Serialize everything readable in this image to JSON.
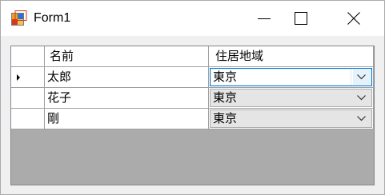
{
  "window": {
    "title": "Form1"
  },
  "grid": {
    "columns": [
      "名前",
      "住居地域"
    ],
    "rows": [
      {
        "name": "太郎",
        "area": "東京",
        "current": true
      },
      {
        "name": "花子",
        "area": "東京",
        "current": false
      },
      {
        "name": "剛",
        "area": "東京",
        "current": false
      }
    ]
  },
  "icons": {
    "app": "form-icon",
    "minimize": "minimize-icon",
    "maximize": "maximize-icon",
    "close": "close-icon",
    "current_row": "row-pointer-icon",
    "dropdown": "chevron-down-icon"
  },
  "colors": {
    "grid_background": "#ababab",
    "selection_border": "#0078d7",
    "combo_background": "#e5e5e5"
  }
}
